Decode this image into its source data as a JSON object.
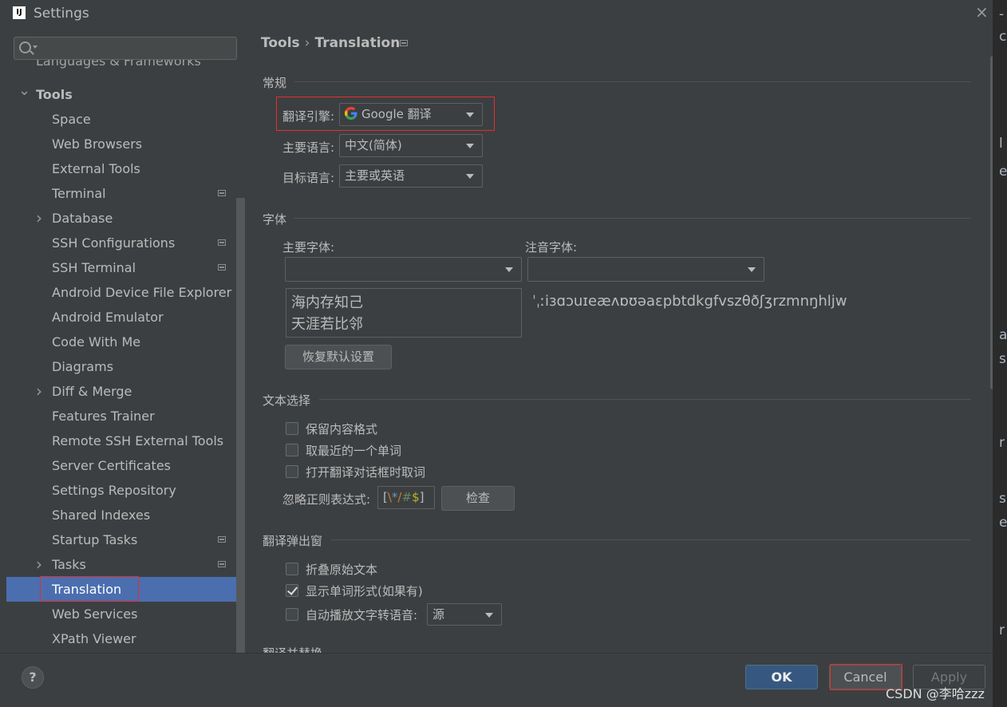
{
  "window": {
    "title": "Settings",
    "icon_name": "intellij-icon"
  },
  "search": {
    "placeholder": ""
  },
  "tree": {
    "partial_item": "Languages & Frameworks",
    "items": [
      {
        "label": "Tools",
        "expander": "expanded"
      },
      {
        "label": "Space"
      },
      {
        "label": "Web Browsers"
      },
      {
        "label": "External Tools"
      },
      {
        "label": "Terminal",
        "project_icon": true
      },
      {
        "label": "Database",
        "expander": "collapsed"
      },
      {
        "label": "SSH Configurations",
        "project_icon": true
      },
      {
        "label": "SSH Terminal",
        "project_icon": true
      },
      {
        "label": "Android Device File Explorer"
      },
      {
        "label": "Android Emulator"
      },
      {
        "label": "Code With Me"
      },
      {
        "label": "Diagrams"
      },
      {
        "label": "Diff & Merge",
        "expander": "collapsed"
      },
      {
        "label": "Features Trainer"
      },
      {
        "label": "Remote SSH External Tools"
      },
      {
        "label": "Server Certificates"
      },
      {
        "label": "Settings Repository"
      },
      {
        "label": "Shared Indexes"
      },
      {
        "label": "Startup Tasks",
        "project_icon": true
      },
      {
        "label": "Tasks",
        "expander": "collapsed",
        "project_icon": true
      },
      {
        "label": "Translation",
        "selected": true
      },
      {
        "label": "Web Services"
      },
      {
        "label": "XPath Viewer"
      }
    ]
  },
  "breadcrumb": {
    "parent": "Tools",
    "separator": "›",
    "current": "Translation"
  },
  "general": {
    "section_title": "常规",
    "engine_label": "翻译引擎:",
    "engine_value": "Google 翻译",
    "primary_lang_label": "主要语言:",
    "primary_lang_value": "中文(简体)",
    "target_lang_label": "目标语言:",
    "target_lang_value": "主要或英语"
  },
  "font": {
    "section_title": "字体",
    "primary_font_label": "主要字体:",
    "primary_font_value": "",
    "phonetic_font_label": "注音字体:",
    "phonetic_font_value": "",
    "preview_line1": "海内存知己",
    "preview_line2": "天涯若比邻",
    "phonetic_preview": "ˈˌːiɜɑɔuɪeæʌɒʊəaɛpbtdkgfvszθðʃʒrzmnŋhljw",
    "reset_button": "恢复默认设置"
  },
  "text_selection": {
    "section_title": "文本选择",
    "opt1": "保留内容格式",
    "opt1_checked": false,
    "opt2": "取最近的一个单词",
    "opt2_checked": false,
    "opt3": "打开翻译对话框时取词",
    "opt3_checked": false,
    "ignore_regex_label": "忽略正则表达式:",
    "regex_parts": [
      "[",
      "\\",
      "*",
      "/",
      "#",
      "$",
      "]"
    ],
    "check_button": "检查"
  },
  "popup": {
    "section_title": "翻译弹出窗",
    "opt1": "折叠原始文本",
    "opt1_checked": false,
    "opt2": "显示单词形式(如果有)",
    "opt2_checked": true,
    "opt3": "自动播放文字转语音:",
    "opt3_checked": false,
    "tts_value": "源"
  },
  "next_section_partial": "翻译并替换",
  "footer": {
    "help_label": "?",
    "ok_label": "OK",
    "cancel_label": "Cancel",
    "apply_label": "Apply"
  },
  "watermark": "CSDN @李哈zzz",
  "colors": {
    "accent": "#4b6eaf",
    "ok_button": "#365880",
    "highlight_box": "#e03030"
  }
}
